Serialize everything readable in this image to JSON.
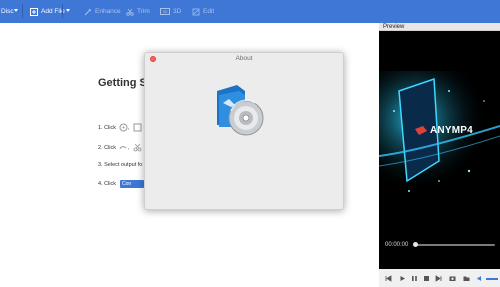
{
  "toolbar": {
    "disc_label": "Disc",
    "add_file_label": "Add File",
    "enhance_label": "Enhance",
    "trim_label": "Trim",
    "threed_label": "3D",
    "edit_label": "Edit",
    "threed_icon_text": "3D"
  },
  "getting_started": {
    "title": "Getting Sta",
    "step1": "1. Click",
    "step1_sep": ",",
    "step2": "2. Click",
    "step2_sep": ",",
    "step3": "3. Select output fo",
    "step4": "4. Click",
    "step4_button": "Con"
  },
  "about_dialog": {
    "title": "About"
  },
  "preview": {
    "header": "Preview",
    "brand": "ANYMP4",
    "time": "00:00:00",
    "progress": 0
  },
  "colors": {
    "toolbar_bg": "#3f77d6",
    "accent": "#3f77d6",
    "close_button": "#ff5f57"
  }
}
